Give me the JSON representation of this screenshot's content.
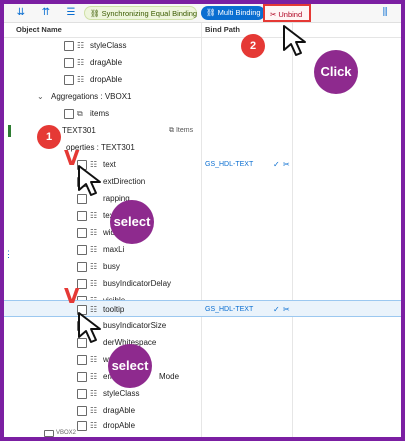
{
  "toolbar": {
    "icons": [
      "expand-all-icon",
      "collapse-icon",
      "tree-toggle-icon"
    ],
    "sync_label": "Synchronizing Equal Binding",
    "multi_label": "Multi Binding",
    "unbind_label": "Unbind",
    "menu_icon": "more-icon"
  },
  "header": {
    "object_name": "Object Name",
    "bind_path": "Bind Path"
  },
  "rows": {
    "r0": "styleClass",
    "r1": "dragAble",
    "r2": "dropAble",
    "r3": "Aggregations : VBOX1",
    "r4": "items",
    "r5": "TEXT301",
    "r5_badge": "Items",
    "r6": "operties : TEXT301",
    "r7": "text",
    "r7_bind": "GS_HDL-TEXT",
    "r8": "extDirection",
    "r9": "rapping",
    "r10": "tex",
    "r11": "wid",
    "r12": "maxLi",
    "r13": "busy",
    "r14": "busyIndicatorDelay",
    "r15": "visible",
    "r16": "tooltip",
    "r16_bind": "GS_HDL-TEXT",
    "r17": "busyIndicatorSize",
    "r18": "derWhitespace",
    "r19": "wra",
    "r20": "Mode",
    "r20_prefix": "em",
    "r21": "styleClass",
    "r22": "dragAble",
    "r23": "dropAble",
    "r24": "VBOX2"
  },
  "annotations": {
    "step1": "1",
    "step2": "2",
    "click_label": "Click",
    "select1": "select",
    "select2": "select"
  },
  "colors": {
    "accent": "#0a6ed1",
    "annotation": "#e53935",
    "bubble": "#8e2a8e",
    "frame": "#7b1fa2"
  }
}
